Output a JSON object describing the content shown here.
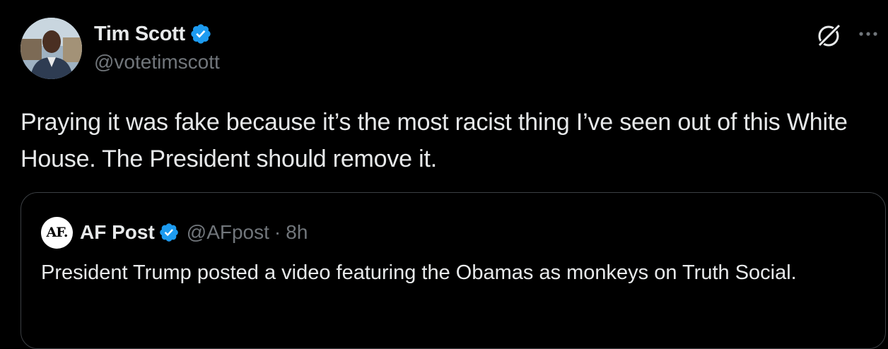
{
  "tweet": {
    "author_name": "Tim Scott",
    "author_handle": "@votetimscott",
    "verified": true,
    "text": "Praying it was fake because it’s the most racist thing I’ve seen out of this White House. The President should remove it."
  },
  "quote": {
    "avatar_text": "AF.",
    "author_name": "AF Post",
    "author_handle": "@AFpost",
    "separator": "·",
    "time": "8h",
    "verified": true,
    "text": "President Trump posted a video featuring the Obamas as monkeys on Truth Social."
  },
  "icons": {
    "verified": "verified-badge-icon",
    "grok": "grok-icon",
    "more": "more-options-icon"
  },
  "colors": {
    "background": "#000000",
    "text_primary": "#e7e9ea",
    "text_secondary": "#71767b",
    "verified_blue": "#1d9bf0",
    "border": "#3b3f43"
  }
}
